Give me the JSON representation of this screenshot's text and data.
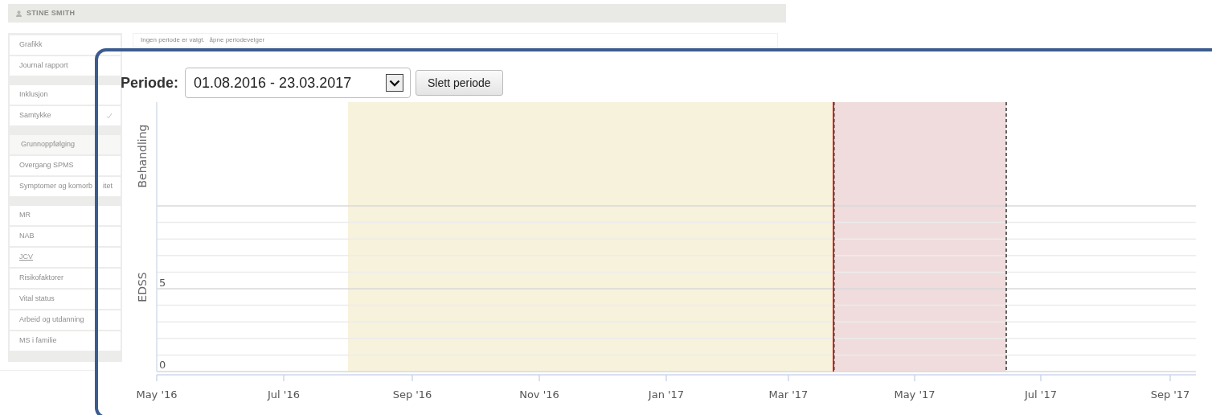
{
  "header": {
    "name": "STINE SMITH"
  },
  "sidebar": {
    "groups": [
      {
        "items": [
          {
            "label": "Grafikk",
            "kind": "item",
            "checked": false,
            "underlined": false
          },
          {
            "label": "Journal rapport",
            "kind": "item",
            "checked": false,
            "underlined": false
          }
        ]
      },
      {
        "items": [
          {
            "label": "Inklusjon",
            "kind": "item",
            "checked": false,
            "underlined": false
          },
          {
            "label": "Samtykke",
            "kind": "item",
            "checked": true,
            "underlined": false
          }
        ]
      },
      {
        "items": [
          {
            "label": "Grunnoppfølging",
            "kind": "heading",
            "checked": false,
            "underlined": false
          },
          {
            "label": "Overgang SPMS",
            "kind": "item",
            "checked": false,
            "underlined": false
          },
          {
            "label": "Symptomer og komorb",
            "tail": "itet",
            "kind": "item",
            "checked": false,
            "underlined": false
          }
        ]
      },
      {
        "items": [
          {
            "label": "MR",
            "kind": "item",
            "checked": false,
            "underlined": false
          },
          {
            "label": "NAB",
            "kind": "item",
            "checked": false,
            "underlined": false
          },
          {
            "label": "JCV",
            "kind": "item",
            "checked": false,
            "underlined": true
          },
          {
            "label": "Risikofaktorer",
            "kind": "item",
            "checked": false,
            "underlined": false
          },
          {
            "label": "Vital status",
            "kind": "item",
            "checked": false,
            "underlined": false
          },
          {
            "label": "Arbeid og utdanning",
            "kind": "item",
            "checked": false,
            "underlined": false
          },
          {
            "label": "MS i familie",
            "kind": "item",
            "checked": false,
            "underlined": false
          }
        ]
      }
    ]
  },
  "notice": {
    "text": "Ingen periode er valgt.",
    "link": "åpne periodevelger"
  },
  "period": {
    "label": "Periode:",
    "value": "01.08.2016 - 23.03.2017",
    "button": "Slett periode"
  },
  "chart": {
    "row_titles": [
      "Behandling",
      "EDSS"
    ],
    "y_labels": [
      "5",
      "0"
    ],
    "x_labels": [
      "May '16",
      "Jul '16",
      "Sep '16",
      "Nov '16",
      "Jan '17",
      "Mar '17",
      "May '17",
      "Jul '17",
      "Sep '17"
    ],
    "bands": [
      {
        "color": "#f7f2dc"
      },
      {
        "color": "#f0dcdd"
      }
    ],
    "markers": [
      {
        "kind": "red-dashed"
      },
      {
        "kind": "dashed"
      }
    ]
  }
}
